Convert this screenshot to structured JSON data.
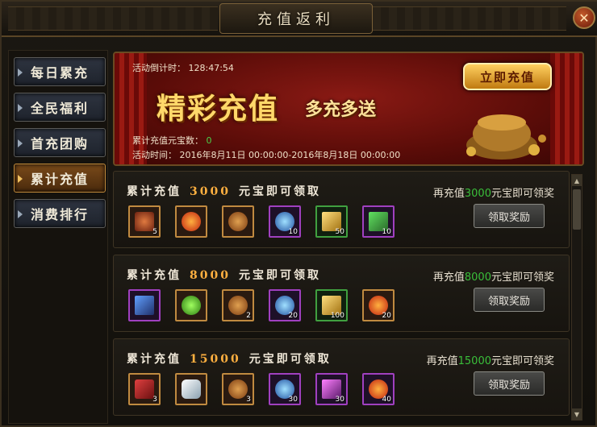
{
  "window": {
    "title": "充值返利",
    "close_icon": "close-icon"
  },
  "sidebar": {
    "items": [
      {
        "label": "每日累充",
        "active": false
      },
      {
        "label": "全民福利",
        "active": false
      },
      {
        "label": "首充团购",
        "active": false
      },
      {
        "label": "累计充值",
        "active": true
      },
      {
        "label": "消费排行",
        "active": false
      }
    ]
  },
  "banner": {
    "countdown_label": "活动倒计时：",
    "countdown_value": "128:47:54",
    "big_title": "精彩充值",
    "sub_title": "多充多送",
    "accumulated_label": "累计充值元宝数：",
    "accumulated_value": "0",
    "period_label": "活动时间：",
    "period_value": "2016年8月11日 00:00:00-2016年8月18日 00:00:00",
    "recharge_button": "立即充值"
  },
  "rewards": [
    {
      "title_prefix": "累计充值",
      "amount": "3000",
      "title_suffix": "元宝即可领取",
      "hint_prefix": "再充值",
      "hint_amount": "3000",
      "hint_suffix": "元宝即可领奖",
      "claim_label": "领取奖励",
      "items": [
        {
          "icon": "scroll-icon",
          "rarity": "orange",
          "count": "5"
        },
        {
          "icon": "fire-orb-icon",
          "rarity": "orange",
          "count": ""
        },
        {
          "icon": "treasure-bag-icon",
          "rarity": "orange",
          "count": ""
        },
        {
          "icon": "crystal-ball-icon",
          "rarity": "purple",
          "count": "10"
        },
        {
          "icon": "gold-book-icon",
          "rarity": "green",
          "count": "50"
        },
        {
          "icon": "jade-talisman-icon",
          "rarity": "purple",
          "count": "10"
        }
      ]
    },
    {
      "title_prefix": "累计充值",
      "amount": "8000",
      "title_suffix": "元宝即可领取",
      "hint_prefix": "再充值",
      "hint_amount": "8000",
      "hint_suffix": "元宝即可领奖",
      "claim_label": "领取奖励",
      "items": [
        {
          "icon": "blue-book-icon",
          "rarity": "purple",
          "count": ""
        },
        {
          "icon": "green-orb-icon",
          "rarity": "orange",
          "count": ""
        },
        {
          "icon": "treasure-bag-icon",
          "rarity": "orange",
          "count": "2"
        },
        {
          "icon": "crystal-ball-icon",
          "rarity": "purple",
          "count": "20"
        },
        {
          "icon": "gold-book-icon",
          "rarity": "green",
          "count": "100"
        },
        {
          "icon": "fire-orb-icon",
          "rarity": "orange",
          "count": "20"
        }
      ]
    },
    {
      "title_prefix": "累计充值",
      "amount": "15000",
      "title_suffix": "元宝即可领取",
      "hint_prefix": "再充值",
      "hint_amount": "15000",
      "hint_suffix": "元宝即可领奖",
      "claim_label": "领取奖励",
      "items": [
        {
          "icon": "red-talisman-icon",
          "rarity": "orange",
          "count": "3"
        },
        {
          "icon": "white-crystal-icon",
          "rarity": "orange",
          "count": ""
        },
        {
          "icon": "treasure-bag-icon",
          "rarity": "orange",
          "count": "3"
        },
        {
          "icon": "crystal-ball-icon",
          "rarity": "purple",
          "count": "30"
        },
        {
          "icon": "magic-staff-icon",
          "rarity": "purple",
          "count": "30"
        },
        {
          "icon": "fire-orb-icon",
          "rarity": "purple",
          "count": "40"
        }
      ]
    }
  ],
  "colors": {
    "accent_gold": "#ffb040",
    "hint_green": "#3abf3a",
    "orange_rarity": "#c08a40",
    "purple_rarity": "#a040c0",
    "green_rarity": "#40a040"
  }
}
